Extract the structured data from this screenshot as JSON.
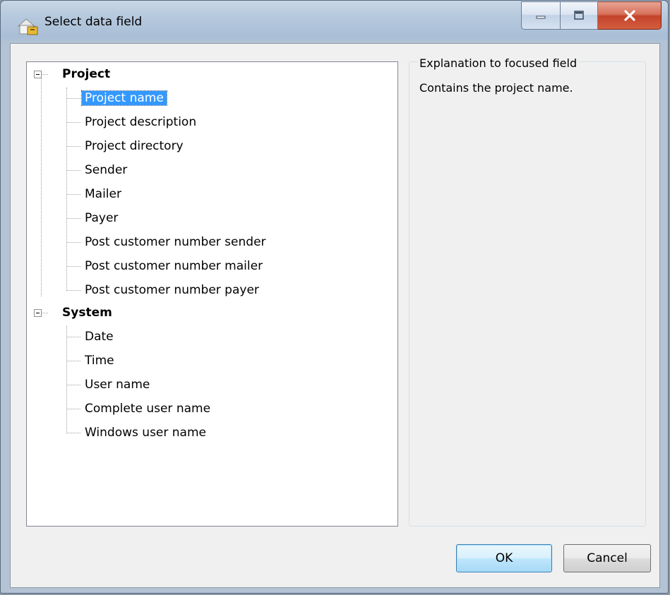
{
  "window": {
    "title": "Select data field"
  },
  "tree": {
    "groups": [
      {
        "label": "Project",
        "items": [
          {
            "label": "Project name",
            "selected": true
          },
          {
            "label": "Project description"
          },
          {
            "label": "Project directory"
          },
          {
            "label": "Sender"
          },
          {
            "label": "Mailer"
          },
          {
            "label": "Payer"
          },
          {
            "label": "Post customer number sender"
          },
          {
            "label": "Post customer number mailer"
          },
          {
            "label": "Post customer number payer"
          }
        ]
      },
      {
        "label": "System",
        "items": [
          {
            "label": "Date"
          },
          {
            "label": "Time"
          },
          {
            "label": "User name"
          },
          {
            "label": "Complete user name"
          },
          {
            "label": "Windows user name"
          }
        ]
      }
    ]
  },
  "explanation": {
    "legend": "Explanation to focused field",
    "text": "Contains the project name."
  },
  "buttons": {
    "ok": "OK",
    "cancel": "Cancel"
  },
  "colors": {
    "selection": "#3399ff",
    "close_button": "#c3432a"
  }
}
